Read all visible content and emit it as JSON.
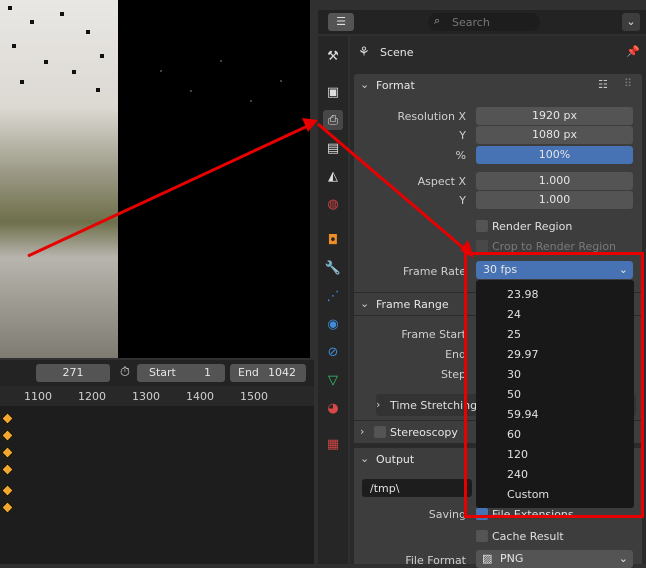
{
  "timeline": {
    "current_frame": "271",
    "start_label": "Start",
    "start_value": "1",
    "end_label": "End",
    "end_value": "1042",
    "ruler": [
      "1100",
      "1200",
      "1300",
      "1400",
      "1500"
    ]
  },
  "header": {
    "search_placeholder": "Search"
  },
  "context": {
    "title": "Scene"
  },
  "format": {
    "title": "Format",
    "resolution_x_label": "Resolution X",
    "resolution_x": "1920 px",
    "y_label": "Y",
    "resolution_y": "1080 px",
    "percent_label": "%",
    "percent": "100%",
    "aspect_x_label": "Aspect X",
    "aspect_x": "1.000",
    "aspect_y_label": "Y",
    "aspect_y": "1.000",
    "render_region": "Render Region",
    "crop_region": "Crop to Render Region",
    "frame_rate_label": "Frame Rate",
    "frame_rate_value": "30 fps",
    "frame_rate_options": [
      "23.98",
      "24",
      "25",
      "29.97",
      "30",
      "50",
      "59.94",
      "60",
      "120",
      "240",
      "Custom"
    ]
  },
  "frame_range": {
    "title": "Frame Range",
    "frame_start_label": "Frame Start",
    "end_label": "End",
    "step_label": "Step",
    "time_stretching": "Time Stretching"
  },
  "stereoscopy": {
    "title": "Stereoscopy"
  },
  "output": {
    "title": "Output",
    "path": "/tmp\\",
    "saving_label": "Saving",
    "file_extensions": "File Extensions",
    "cache_result": "Cache Result",
    "file_format_label": "File Format",
    "file_format_value": "PNG"
  },
  "colors": {
    "accent": "#4772b3",
    "annotation": "#e80000",
    "keyframe": "#f0a830"
  }
}
